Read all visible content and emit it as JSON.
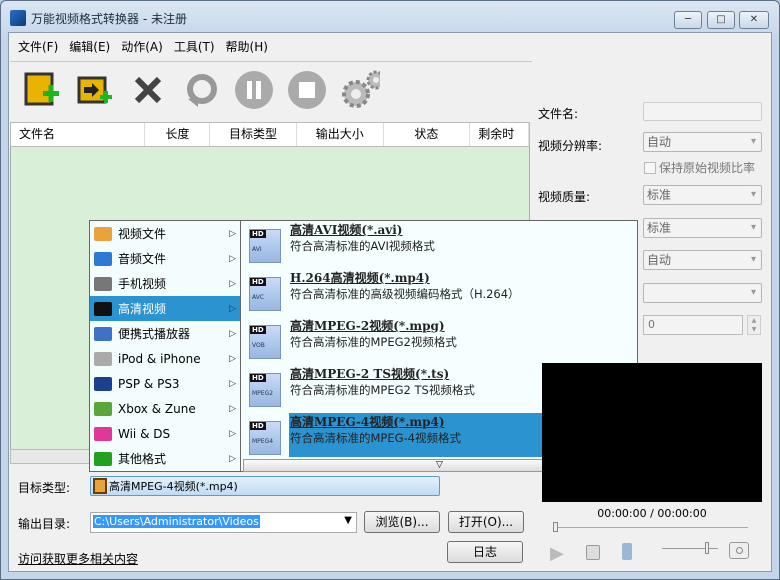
{
  "window": {
    "title": "万能视频格式转换器 - 未注册",
    "controls": [
      "minimize",
      "maximize",
      "close"
    ]
  },
  "menu": [
    "文件(F)",
    "编辑(E)",
    "动作(A)",
    "工具(T)",
    "帮助(H)"
  ],
  "toolbar": [
    {
      "icon": "add-video-icon"
    },
    {
      "icon": "import-video-icon"
    },
    {
      "icon": "delete-icon"
    },
    {
      "icon": "reset-icon"
    },
    {
      "icon": "pause-icon"
    },
    {
      "icon": "stop-icon"
    },
    {
      "icon": "settings-icon"
    }
  ],
  "table": {
    "columns": [
      "文件名",
      "长度",
      "目标类型",
      "输出大小",
      "状态",
      "剩余时"
    ],
    "rows": []
  },
  "categories": [
    {
      "label": "视频文件",
      "color": "#e8a33a"
    },
    {
      "label": "音频文件",
      "color": "#2c7ad6"
    },
    {
      "label": "手机视频",
      "color": "#777777"
    },
    {
      "label": "高清视频",
      "color": "#111111",
      "selected": true
    },
    {
      "label": "便携式播放器",
      "color": "#3d72c8"
    },
    {
      "label": "iPod & iPhone",
      "color": "#aaaaaa"
    },
    {
      "label": "PSP & PS3",
      "color": "#1c3f8f"
    },
    {
      "label": "Xbox & Zune",
      "color": "#5ca53a"
    },
    {
      "label": "Wii & DS",
      "color": "#e0389a"
    },
    {
      "label": "其他格式",
      "color": "#22a022"
    }
  ],
  "formats": [
    {
      "badge": "AVI",
      "title": "高清AVI视频(*.avi)",
      "desc": "符合高清标准的AVI视频格式"
    },
    {
      "badge": "AVC",
      "title": "H.264高清视频(*.mp4)",
      "desc": "符合高清标准的高级视频编码格式（H.264）"
    },
    {
      "badge": "VOB",
      "title": "高清MPEG-2视频(*.mpg)",
      "desc": "符合高清标准的MPEG2视频格式"
    },
    {
      "badge": "MPEG2",
      "title": "高清MPEG-2 TS视频(*.ts)",
      "desc": "符合高清标准的MPEG2 TS视频格式"
    },
    {
      "badge": "MPEG4",
      "title": "高清MPEG-4视频(*.mp4)",
      "desc": "符合高清标准的MPEG-4视频格式",
      "selected": true
    }
  ],
  "target": {
    "label": "目标类型:",
    "value": "高清MPEG-4视频(*.mp4)"
  },
  "output": {
    "label": "输出目录:",
    "value": "C:\\Users\\Administrator\\Videos",
    "browse": "浏览(B)...",
    "open": "打开(O)..."
  },
  "log_button": "日志",
  "link": "访问获取更多相关内容",
  "settings": {
    "filename_label": "文件名:",
    "filename_value": "",
    "resolution_label": "视频分辨率:",
    "resolution_value": "自动",
    "keep_ratio": "保持原始视频比率",
    "keep_ratio_checked": false,
    "quality_label": "视频质量:",
    "quality_value": "标准",
    "combo4": "标准",
    "combo5": "自动",
    "combo6": "",
    "spin_value": "0"
  },
  "player": {
    "time": "00:00:00 / 00:00:00",
    "progress": 0,
    "volume": 0.5
  }
}
